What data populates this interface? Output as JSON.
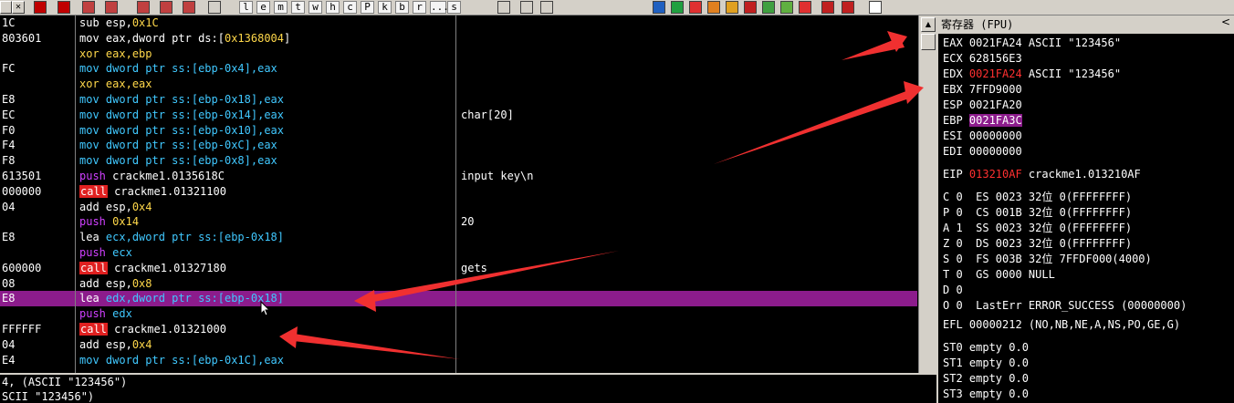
{
  "toolbar": {
    "letters": [
      "l",
      "e",
      "m",
      "t",
      "w",
      "h",
      "c",
      "P",
      "k",
      "b",
      "r",
      "...",
      "s"
    ]
  },
  "disasm": [
    {
      "addr": "1C",
      "mnemonic": "sub",
      "mcolor": "white",
      "ops": [
        {
          "t": "esp,",
          "c": "op-reg"
        },
        {
          "t": "0x1C",
          "c": "op-num"
        }
      ],
      "comment": ""
    },
    {
      "addr": "803601",
      "mnemonic": "mov",
      "mcolor": "white",
      "ops": [
        {
          "t": "eax,dword ptr ds:[",
          "c": "op-reg"
        },
        {
          "t": "0x1368004",
          "c": "op-num"
        },
        {
          "t": "]",
          "c": "op-reg"
        }
      ],
      "comment": ""
    },
    {
      "addr": "",
      "mnemonic": "xor",
      "mcolor": "yellow",
      "ops": [
        {
          "t": "eax,ebp",
          "c": "op-num"
        }
      ],
      "comment": ""
    },
    {
      "addr": "FC",
      "mnemonic": "mov",
      "mcolor": "blue",
      "ops": [
        {
          "t": "dword ptr ss:[ebp-0x4],eax",
          "c": "op-ptr"
        }
      ],
      "comment": ""
    },
    {
      "addr": "",
      "mnemonic": "xor",
      "mcolor": "yellow",
      "ops": [
        {
          "t": "eax,eax",
          "c": "op-num"
        }
      ],
      "comment": ""
    },
    {
      "addr": "E8",
      "mnemonic": "mov",
      "mcolor": "blue",
      "ops": [
        {
          "t": "dword ptr ss:[ebp-0x18],eax",
          "c": "op-ptr"
        }
      ],
      "comment": ""
    },
    {
      "addr": "EC",
      "mnemonic": "mov",
      "mcolor": "blue",
      "ops": [
        {
          "t": "dword ptr ss:[ebp-0x14],eax",
          "c": "op-ptr"
        }
      ],
      "comment": "char[20]"
    },
    {
      "addr": "F0",
      "mnemonic": "mov",
      "mcolor": "blue",
      "ops": [
        {
          "t": "dword ptr ss:[ebp-0x10],eax",
          "c": "op-ptr"
        }
      ],
      "comment": ""
    },
    {
      "addr": "F4",
      "mnemonic": "mov",
      "mcolor": "blue",
      "ops": [
        {
          "t": "dword ptr ss:[ebp-0xC],eax",
          "c": "op-ptr"
        }
      ],
      "comment": ""
    },
    {
      "addr": "F8",
      "mnemonic": "mov",
      "mcolor": "blue",
      "ops": [
        {
          "t": "dword ptr ss:[ebp-0x8],eax",
          "c": "op-ptr"
        }
      ],
      "comment": ""
    },
    {
      "addr": "613501",
      "mnemonic": "push",
      "mcolor": "purple",
      "ops": [
        {
          "t": "crackme1.0135618C",
          "c": "op-reg"
        }
      ],
      "comment": "input key\\n"
    },
    {
      "addr": "000000",
      "mnemonic": "call",
      "mcolor": "call",
      "ops": [
        {
          "t": "crackme1.01321100",
          "c": "op-reg"
        }
      ],
      "comment": ""
    },
    {
      "addr": "04",
      "mnemonic": "add",
      "mcolor": "white",
      "ops": [
        {
          "t": "esp,",
          "c": "op-reg"
        },
        {
          "t": "0x4",
          "c": "op-num"
        }
      ],
      "comment": ""
    },
    {
      "addr": "",
      "mnemonic": "push",
      "mcolor": "purple",
      "ops": [
        {
          "t": "0x14",
          "c": "op-num"
        }
      ],
      "comment": "20"
    },
    {
      "addr": "E8",
      "mnemonic": "lea",
      "mcolor": "white",
      "ops": [
        {
          "t": "ecx,dword ptr ss:[ebp-0x18]",
          "c": "op-ptr"
        }
      ],
      "comment": ""
    },
    {
      "addr": "",
      "mnemonic": "push",
      "mcolor": "purple",
      "ops": [
        {
          "t": "ecx",
          "c": "op-ptr"
        }
      ],
      "comment": ""
    },
    {
      "addr": "600000",
      "mnemonic": "call",
      "mcolor": "call",
      "ops": [
        {
          "t": "crackme1.01327180",
          "c": "op-reg"
        }
      ],
      "comment": "gets"
    },
    {
      "addr": "08",
      "mnemonic": "add",
      "mcolor": "white",
      "ops": [
        {
          "t": "esp,",
          "c": "op-reg"
        },
        {
          "t": "0x8",
          "c": "op-num"
        }
      ],
      "comment": ""
    },
    {
      "addr": "E8",
      "mnemonic": "lea",
      "mcolor": "white",
      "ops": [
        {
          "t": "edx,dword ptr ss:[ebp-0x18]",
          "c": "op-ptr"
        }
      ],
      "comment": "",
      "selected": true
    },
    {
      "addr": "",
      "mnemonic": "push",
      "mcolor": "purple",
      "ops": [
        {
          "t": "edx",
          "c": "op-ptr"
        }
      ],
      "comment": ""
    },
    {
      "addr": "FFFFFF",
      "mnemonic": "call",
      "mcolor": "call",
      "ops": [
        {
          "t": "crackme1.01321000",
          "c": "op-reg"
        }
      ],
      "comment": ""
    },
    {
      "addr": "04",
      "mnemonic": "add",
      "mcolor": "white",
      "ops": [
        {
          "t": "esp,",
          "c": "op-reg"
        },
        {
          "t": "0x4",
          "c": "op-num"
        }
      ],
      "comment": ""
    },
    {
      "addr": "E4",
      "mnemonic": "mov",
      "mcolor": "blue",
      "ops": [
        {
          "t": "dword ptr ss:[ebp-0x1C],eax",
          "c": "op-ptr"
        }
      ],
      "comment": ""
    }
  ],
  "info": {
    "line1": "4, (ASCII \"123456\")",
    "line2": "SCII \"123456\")"
  },
  "registers": {
    "title": "寄存器 (FPU)",
    "collapse": "<",
    "general": [
      {
        "name": "EAX",
        "value": "0021FA24",
        "note": "ASCII \"123456\"",
        "value_style": "normal"
      },
      {
        "name": "ECX",
        "value": "628156E3",
        "note": "",
        "value_style": "normal"
      },
      {
        "name": "EDX",
        "value": "0021FA24",
        "note": "ASCII \"123456\"",
        "value_style": "red"
      },
      {
        "name": "EBX",
        "value": "7FFD9000",
        "note": "",
        "value_style": "normal"
      },
      {
        "name": "ESP",
        "value": "0021FA20",
        "note": "",
        "value_style": "normal"
      },
      {
        "name": "EBP",
        "value": "0021FA3C",
        "note": "",
        "value_style": "highlight"
      },
      {
        "name": "ESI",
        "value": "00000000",
        "note": "",
        "value_style": "normal"
      },
      {
        "name": "EDI",
        "value": "00000000",
        "note": "",
        "value_style": "normal"
      }
    ],
    "eip": {
      "name": "EIP",
      "value": "013210AF",
      "note": "crackme1.013210AF"
    },
    "flags": [
      "C 0  ES 0023 32位 0(FFFFFFFF)",
      "P 0  CS 001B 32位 0(FFFFFFFF)",
      "A 1  SS 0023 32位 0(FFFFFFFF)",
      "Z 0  DS 0023 32位 0(FFFFFFFF)",
      "S 0  FS 003B 32位 7FFDF000(4000)",
      "T 0  GS 0000 NULL",
      "D 0",
      "O 0  LastErr ERROR_SUCCESS (00000000)"
    ],
    "efl": "EFL 00000212 (NO,NB,NE,A,NS,PO,GE,G)",
    "fpu": [
      "ST0 empty 0.0",
      "ST1 empty 0.0",
      "ST2 empty 0.0",
      "ST3 empty 0.0"
    ]
  },
  "colors": {
    "selection": "#8c1c8c",
    "call_bg": "#e02020",
    "annotation_arrow": "#f03030"
  }
}
